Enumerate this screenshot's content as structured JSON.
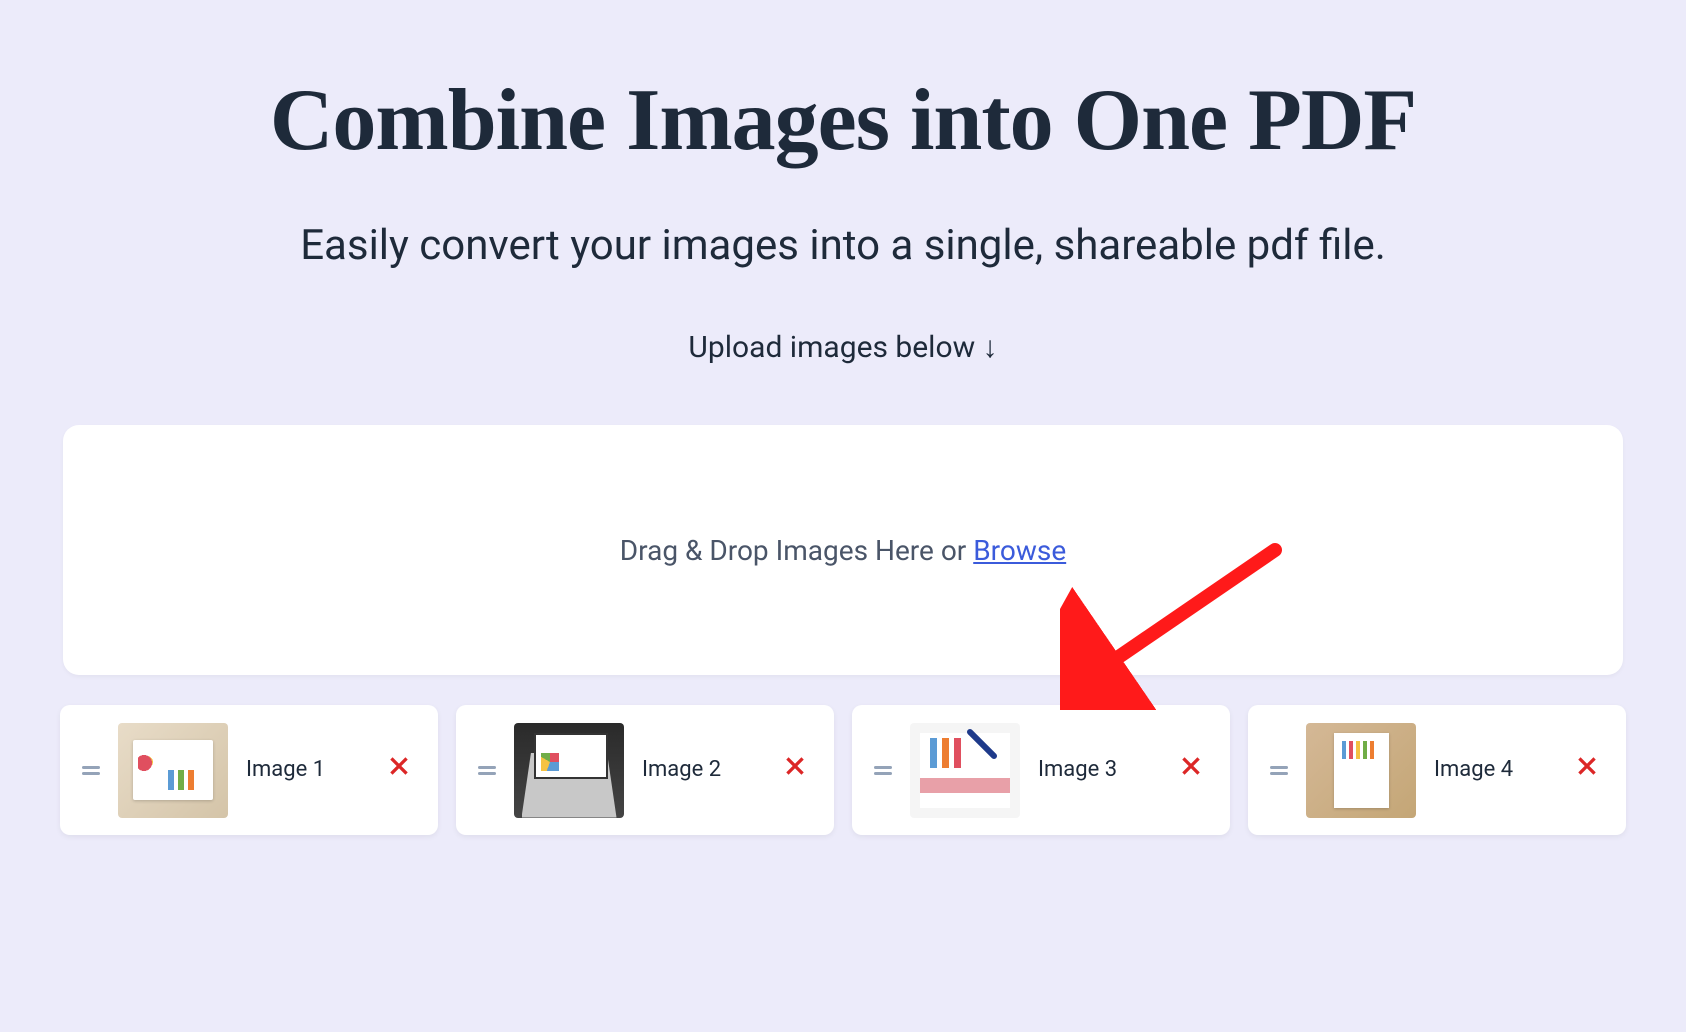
{
  "header": {
    "title": "Combine Images into One PDF",
    "subtitle": "Easily convert your images into a single, shareable pdf file.",
    "instruction": "Upload images below ↓"
  },
  "dropzone": {
    "text": "Drag & Drop Images Here or ",
    "browse_label": "Browse"
  },
  "cards": [
    {
      "label": "Image 1"
    },
    {
      "label": "Image 2"
    },
    {
      "label": "Image 3"
    },
    {
      "label": "Image 4"
    }
  ]
}
